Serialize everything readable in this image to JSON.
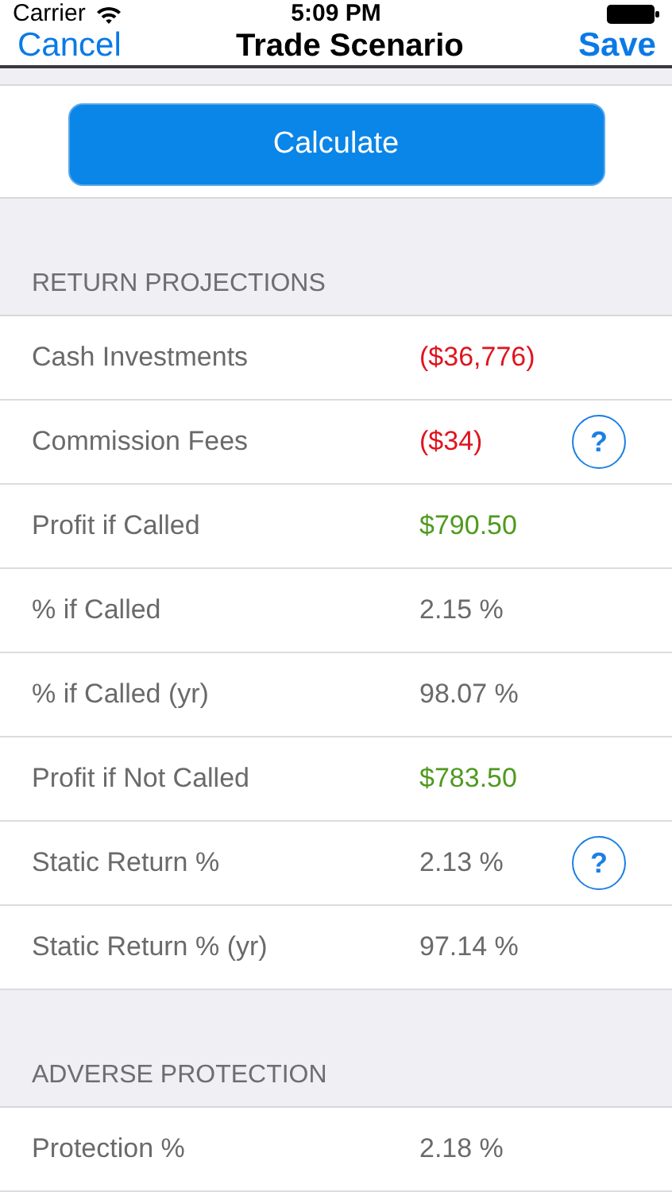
{
  "status_bar": {
    "carrier": "Carrier",
    "time": "5:09 PM"
  },
  "nav": {
    "cancel": "Cancel",
    "title": "Trade Scenario",
    "save": "Save"
  },
  "calculate_button": "Calculate",
  "sections": [
    {
      "header": "RETURN PROJECTIONS",
      "rows": [
        {
          "label": "Cash Investments",
          "value": "($36,776)",
          "color": "#e0141e"
        },
        {
          "label": "Commission Fees",
          "value": "($34)",
          "color": "#e0141e",
          "help": "?"
        },
        {
          "label": "Profit if Called",
          "value": "$790.50",
          "color": "#4f9a1f"
        },
        {
          "label": "% if Called",
          "value": "2.15 %",
          "color": "#6a6a6a"
        },
        {
          "label": "% if Called (yr)",
          "value": "98.07 %",
          "color": "#6a6a6a"
        },
        {
          "label": "Profit if Not Called",
          "value": "$783.50",
          "color": "#4f9a1f"
        },
        {
          "label": "Static Return %",
          "value": "2.13 %",
          "color": "#6a6a6a",
          "help": "?"
        },
        {
          "label": "Static Return % (yr)",
          "value": "97.14 %",
          "color": "#6a6a6a"
        }
      ]
    },
    {
      "header": "ADVERSE PROTECTION",
      "rows": [
        {
          "label": "Protection %",
          "value": "2.18 %",
          "color": "#6a6a6a"
        }
      ]
    }
  ]
}
